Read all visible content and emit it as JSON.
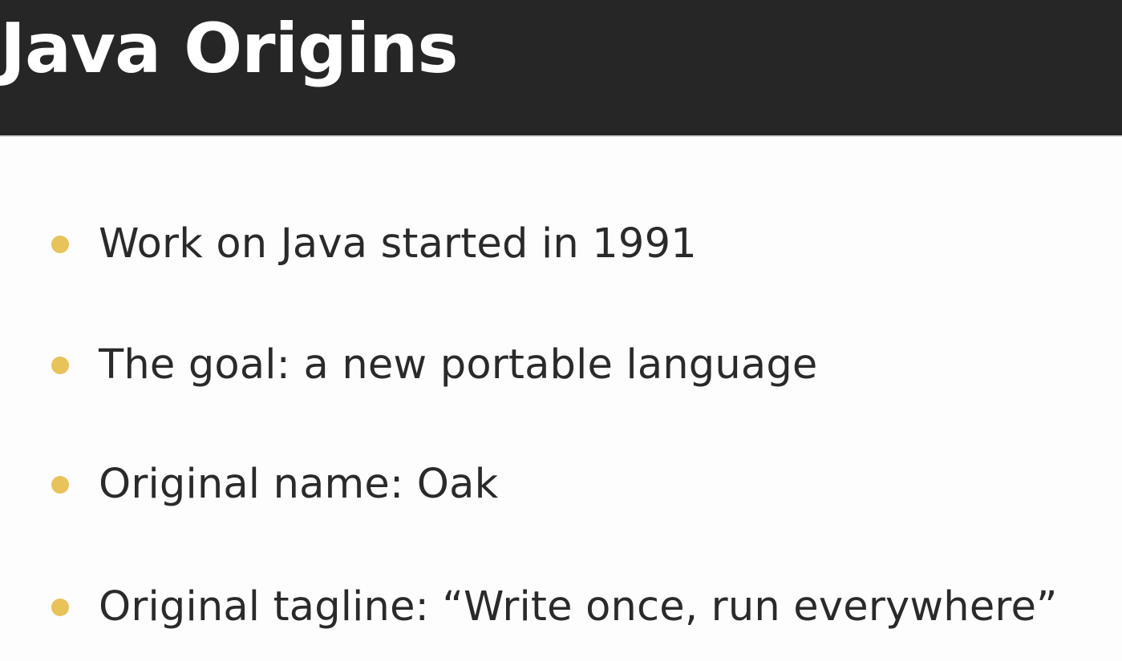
{
  "slide": {
    "title": "Java Origins",
    "bullets": [
      "Work on Java started in 1991",
      "The goal: a new portable language",
      "Original name: Oak",
      "Original tagline: “Write once, run everywhere”"
    ]
  },
  "colors": {
    "title_bar": "#262626",
    "title_text": "#ffffff",
    "body_background": "#fdfdfd",
    "bullet_dot": "#e8c35a",
    "body_text": "#2a2a2a"
  }
}
